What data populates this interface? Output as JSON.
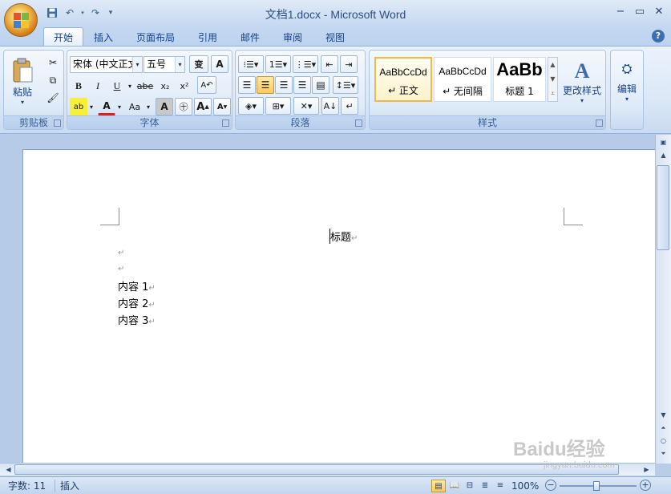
{
  "window": {
    "title": "文档1.docx - Microsoft Word"
  },
  "qat": {
    "save_icon": "save-icon",
    "undo_icon": "undo-icon",
    "redo_icon": "redo-icon",
    "customize_icon": "customize-icon"
  },
  "tabs": [
    {
      "label": "开始",
      "active": true
    },
    {
      "label": "插入"
    },
    {
      "label": "页面布局"
    },
    {
      "label": "引用"
    },
    {
      "label": "邮件"
    },
    {
      "label": "审阅"
    },
    {
      "label": "视图"
    }
  ],
  "ribbon": {
    "clipboard": {
      "label": "剪贴板",
      "paste_label": "粘贴"
    },
    "font": {
      "label": "字体",
      "font_name": "宋体 (中文正文",
      "font_size": "五号",
      "bold": "B",
      "italic": "I",
      "underline": "U",
      "strike": "abe",
      "subscript": "x₂",
      "superscript": "x²",
      "grow": "A",
      "shrink": "A",
      "change_case": "Aa"
    },
    "paragraph": {
      "label": "段落"
    },
    "styles": {
      "label": "样式",
      "items": [
        {
          "sample": "AaBbCcDd",
          "name": "↵ 正文",
          "selected": true
        },
        {
          "sample": "AaBbCcDd",
          "name": "↵ 无间隔"
        },
        {
          "sample": "AaBb",
          "name": "标题 1"
        }
      ],
      "change_styles": "更改样式"
    },
    "editing": {
      "label": "编辑"
    }
  },
  "document": {
    "title_line": "标题",
    "lines": [
      "",
      "",
      "内容 1",
      "内容 2",
      "内容 3"
    ],
    "pilcrow": "↵"
  },
  "statusbar": {
    "word_count": "字数: 11",
    "insert_mode": "插入",
    "zoom": "100%"
  },
  "watermark": {
    "brand": "Baidu经验",
    "url": "jingyan.baidu.com"
  },
  "colors": {
    "accent": "#15428b",
    "ribbon_bg": "#dce8f7",
    "page": "#ffffff"
  }
}
